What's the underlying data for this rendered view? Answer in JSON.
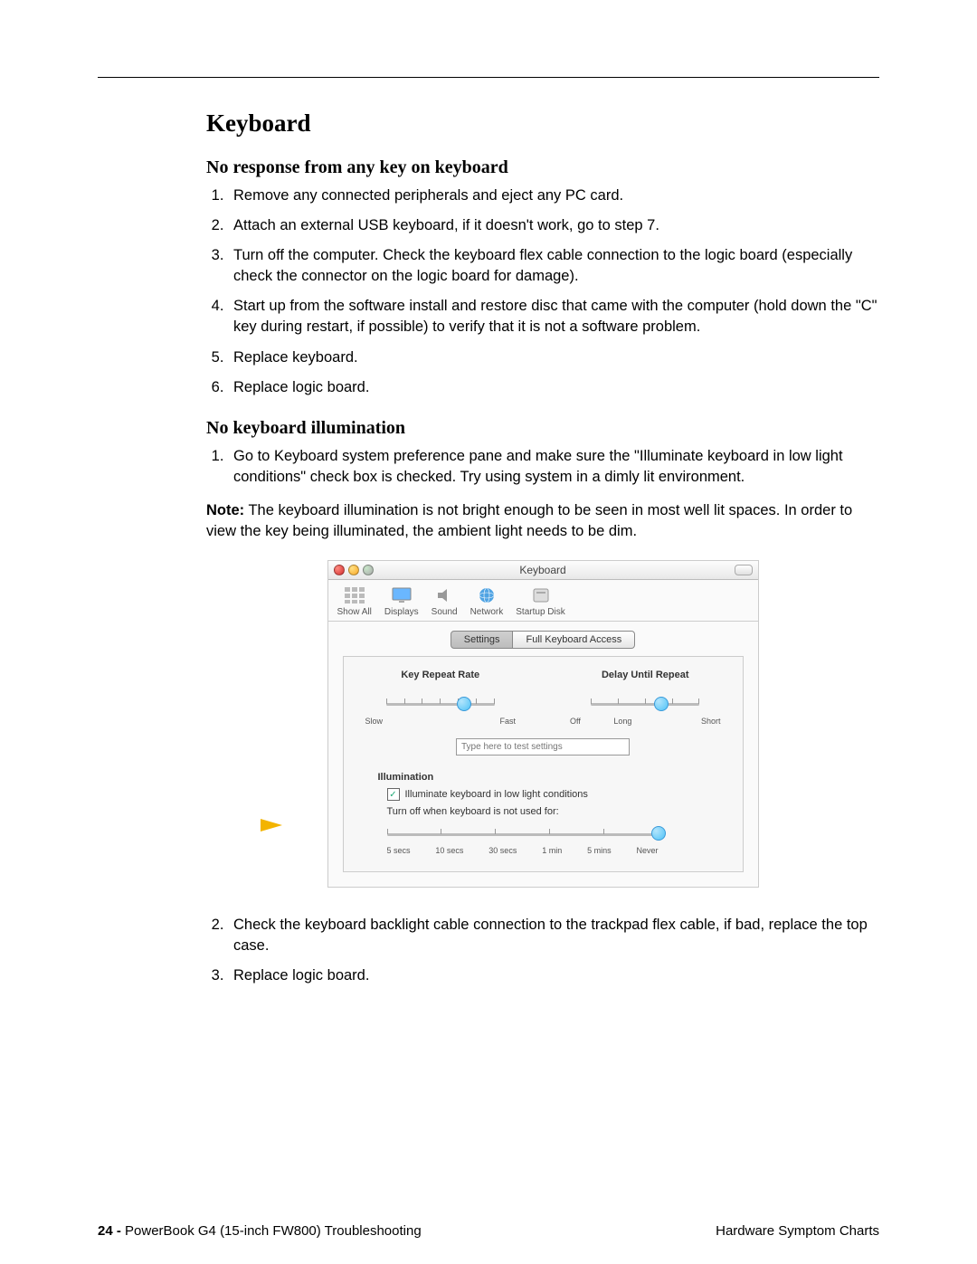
{
  "section_title": "Keyboard",
  "sub1": {
    "title": "No response from any key on keyboard",
    "steps": [
      "Remove any connected peripherals and eject any PC card.",
      "Attach an external USB keyboard, if it doesn't work, go to step 7.",
      "Turn off the computer. Check the keyboard flex cable connection to the logic board (especially check the connector on the logic board for damage).",
      "Start up from the software install and restore disc that came with the computer (hold down the \"C\" key during restart, if possible) to verify that it is not a software problem.",
      "Replace keyboard.",
      "Replace logic board."
    ]
  },
  "sub2": {
    "title": "No keyboard illumination",
    "step1": "Go to Keyboard system preference pane and make sure the \"Illuminate keyboard in low light conditions\" check box is checked. Try using system in a dimly lit environment.",
    "note_label": "Note:",
    "note_body": " The keyboard illumination is not bright enough to be seen in most well lit spaces. In order to view the key being illuminated, the ambient light needs to be dim.",
    "steps_after": [
      "Check the keyboard backlight cable connection to the trackpad flex cable, if bad, replace the top case.",
      "Replace logic board."
    ]
  },
  "prefpane": {
    "window_title": "Keyboard",
    "toolbar": {
      "show_all": "Show All",
      "displays": "Displays",
      "sound": "Sound",
      "network": "Network",
      "startup_disk": "Startup Disk"
    },
    "tabs": {
      "settings": "Settings",
      "fka": "Full Keyboard Access"
    },
    "repeat": {
      "label": "Key Repeat Rate",
      "slow": "Slow",
      "fast": "Fast"
    },
    "delay": {
      "label": "Delay Until Repeat",
      "off": "Off",
      "long": "Long",
      "short": "Short"
    },
    "test_placeholder": "Type here to test settings",
    "illumination_label": "Illumination",
    "illum_checkbox": "Illuminate keyboard in low light conditions",
    "turn_off_text": "Turn off when keyboard is not used for:",
    "timeouts": [
      "5 secs",
      "10 secs",
      "30 secs",
      "1 min",
      "5 mins",
      "Never"
    ]
  },
  "footer": {
    "page_no": "24 - ",
    "doc": "PowerBook G4 (15-inch FW800) Troubleshooting",
    "right": "Hardware Symptom Charts"
  }
}
